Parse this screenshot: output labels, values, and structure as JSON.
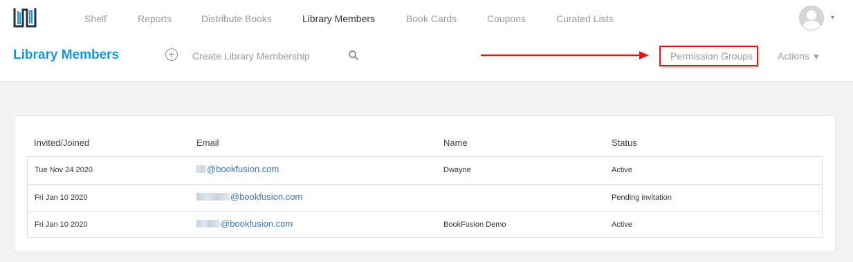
{
  "nav": {
    "items": [
      {
        "label": "Shelf",
        "active": false
      },
      {
        "label": "Reports",
        "active": false
      },
      {
        "label": "Distribute Books",
        "active": false
      },
      {
        "label": "Library Members",
        "active": true
      },
      {
        "label": "Book Cards",
        "active": false
      },
      {
        "label": "Coupons",
        "active": false
      },
      {
        "label": "Curated Lists",
        "active": false
      }
    ],
    "user_menu_icon": "chevron-down-icon"
  },
  "header": {
    "title": "Library Members",
    "create_label": "Create Library Membership",
    "permission_groups_label": "Permission Groups",
    "actions_label": "Actions",
    "actions_caret": "▼"
  },
  "table": {
    "columns": [
      "Invited/Joined",
      "Email",
      "Name",
      "Status"
    ],
    "rows": [
      {
        "joined": "Tue Nov 24 2020",
        "email": "@bookfusion.com",
        "name": "Dwayne",
        "status": "Active"
      },
      {
        "joined": "Fri Jan 10 2020",
        "email": "@bookfusion.com",
        "name": "",
        "status": "Pending invitation"
      },
      {
        "joined": "Fri Jan 10 2020",
        "email": "@bookfusion.com",
        "name": "BookFusion Demo",
        "status": "Active"
      }
    ]
  },
  "colors": {
    "accent": "#1b94d3",
    "link": "#3b79b4",
    "annotation_red": "#e2151b",
    "nav_muted": "#9a9a9a"
  }
}
